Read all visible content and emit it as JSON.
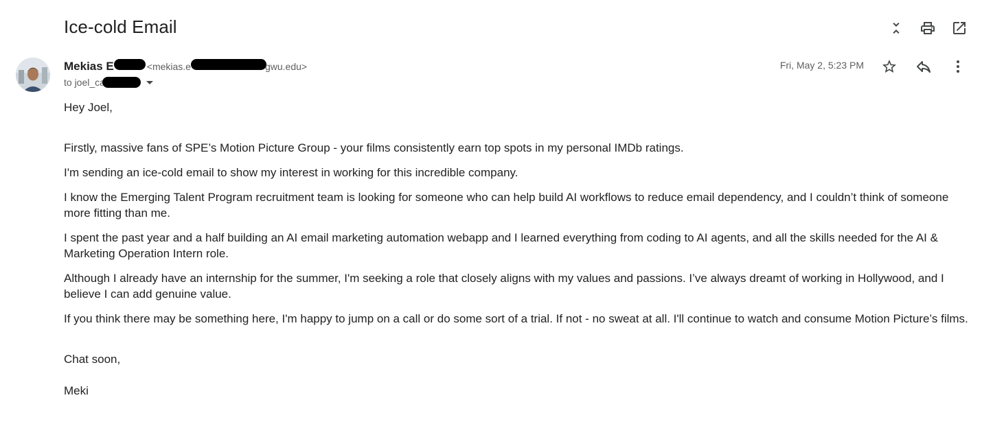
{
  "email": {
    "subject": "Ice-cold Email",
    "sender_name_visible": "Mekias E",
    "sender_email_prefix": "<mekias.e",
    "sender_email_suffix": "gwu.edu>",
    "recipient_prefix": "to joel_ca",
    "date": "Fri, May 2, 5:23 PM"
  },
  "icons": {
    "collapse": "unfold-less-icon",
    "print": "print-icon",
    "open_new": "open-in-new-icon",
    "star": "star-outline-icon",
    "reply": "reply-icon",
    "more": "more-vertical-icon"
  },
  "body": {
    "greeting": "Hey Joel,",
    "paragraphs": [
      "Firstly, massive fans of SPE’s Motion Picture Group - your films consistently earn top spots in my personal IMDb ratings.",
      "I'm sending an ice-cold email to show my interest in working for this incredible company.",
      "I know the Emerging Talent Program recruitment team is looking for someone who can help build  AI workflows to reduce email dependency, and I couldn’t think of someone more fitting than me.",
      "I spent the past year and a half building an AI email marketing automation webapp and I learned everything from coding to AI agents, and all the skills needed for the AI & Marketing Operation Intern role.",
      "Although I already have an internship for the summer, I'm seeking a role that closely aligns with my values and passions. I’ve always dreamt of working in Hollywood, and I believe I can add genuine value.",
      "If you think there may be something here, I'm happy to jump on a call or do some sort of a trial. If not - no sweat at all. I'll continue to watch and consume Motion Picture’s films."
    ],
    "signoff": "Chat soon,",
    "signature": "Meki"
  },
  "colors": {
    "text": "#222222",
    "muted": "#5e5e5e",
    "icon": "#444746"
  }
}
